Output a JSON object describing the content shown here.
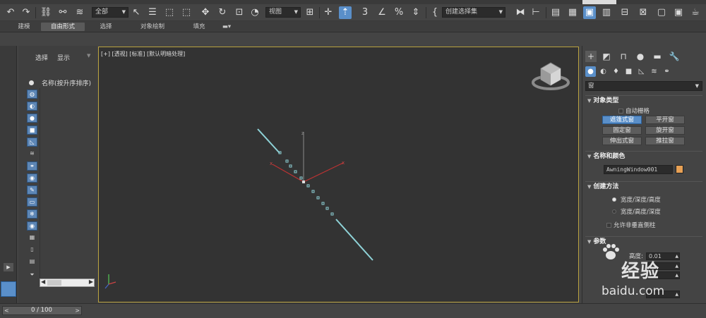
{
  "toolbar": {
    "selection_filter": "全部",
    "ref_coord": "视图",
    "named_selection": "创建选择集"
  },
  "ribbon": {
    "tabs": [
      "建模",
      "自由形式",
      "选择",
      "对象绘制",
      "填充"
    ],
    "active_tab": "自由形式"
  },
  "explorer": {
    "tab_select": "选择",
    "tab_display": "显示",
    "column_header": "名称(按升序排序)"
  },
  "viewport": {
    "label": "[+] [透视] [标准] [默认明暗处理]",
    "axis_label": "z"
  },
  "command_panel": {
    "category": "窗",
    "object_type": {
      "title": "对象类型",
      "autogrid_label": "自动栅格",
      "buttons": [
        "遮篷式窗",
        "平开窗",
        "固定窗",
        "旋开窗",
        "伸出式窗",
        "推拉窗"
      ],
      "selected": "遮篷式窗"
    },
    "name_color": {
      "title": "名称和颜色",
      "name_value": "AwningWindow001",
      "color": "#e8a155"
    },
    "creation_method": {
      "title": "创建方法",
      "options": [
        "宽度/深度/高度",
        "宽度/高度/深度"
      ],
      "selected_index": 0,
      "allow_nonvertical": "允许非垂直侧柱"
    },
    "params": {
      "title": "参数",
      "height_label": "高度:",
      "height_value": "0.01"
    }
  },
  "watermark": {
    "brand": "经验",
    "url": "baidu.com"
  },
  "timeline": {
    "frame_text": "0 / 100"
  }
}
